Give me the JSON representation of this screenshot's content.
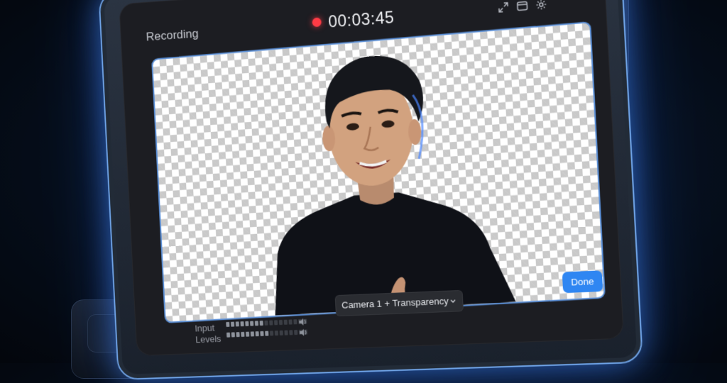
{
  "window": {
    "title": "Recording",
    "timer": "00:03:45",
    "recording_indicator_color": "#ff3b45"
  },
  "toolbar": {
    "icons": [
      "expand-icon",
      "window-icon",
      "gear-icon"
    ]
  },
  "preview": {
    "background": "transparency-checkerboard",
    "subject": "person-cutout"
  },
  "footer": {
    "input_levels_label_line1": "Input",
    "input_levels_label_line2": "Levels",
    "meter_top_active": 8,
    "meter_bottom_active": 9,
    "meter_segments": 17,
    "source_select_value": "Camera 1 + Transparency",
    "done_label": "Done"
  },
  "colors": {
    "accent": "#2f86f2",
    "frame_glow": "#6fa3e6",
    "panel": "#1c1d22"
  }
}
